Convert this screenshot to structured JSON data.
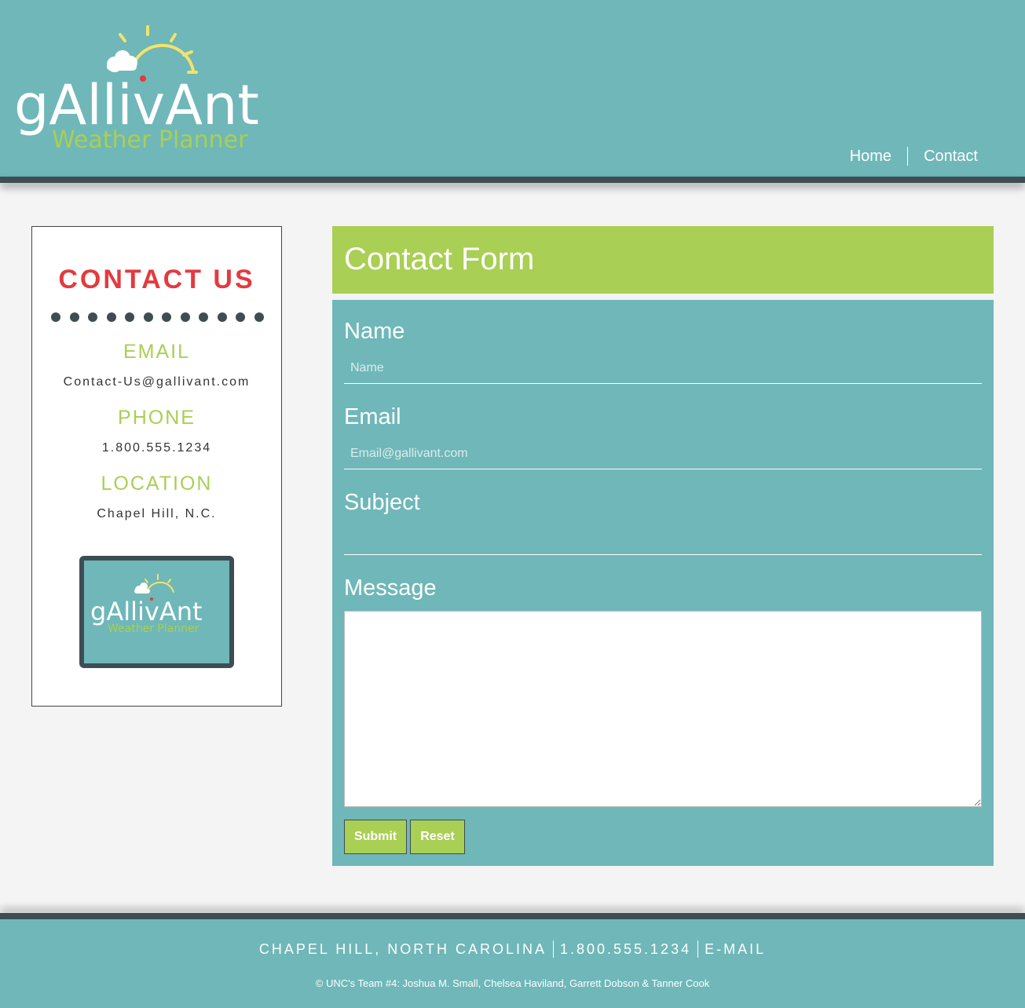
{
  "brand": {
    "name": "gAllivAnt",
    "tagline": "Weather Planner"
  },
  "nav": {
    "items": [
      "Home",
      "Contact"
    ]
  },
  "sidebar": {
    "title": "CONTACT US",
    "email_heading": "EMAIL",
    "email_value": "Contact-Us@gallivant.com",
    "phone_heading": "PHONE",
    "phone_value": "1.800.555.1234",
    "location_heading": "LOCATION",
    "location_value": "Chapel Hill, N.C."
  },
  "form": {
    "title": "Contact Form",
    "name_label": "Name",
    "name_placeholder": "Name",
    "email_label": "Email",
    "email_placeholder": "Email@gallivant.com",
    "subject_label": "Subject",
    "message_label": "Message",
    "submit_label": "Submit",
    "reset_label": "Reset"
  },
  "footer": {
    "location": "CHAPEL HILL, NORTH CAROLINA",
    "phone": "1.800.555.1234",
    "email": "E-MAIL",
    "copyright": "© UNC's Team #4: Joshua M. Small, Chelsea Haviland, Garrett Dobson & Tanner Cook"
  },
  "colors": {
    "teal": "#6fb7b9",
    "green": "#a9cf54",
    "dark": "#3e4d54",
    "red": "#e23b3f",
    "sun": "#f2e36b"
  }
}
